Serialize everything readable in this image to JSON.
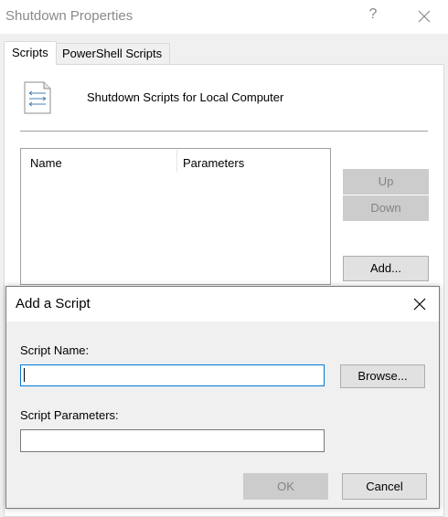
{
  "background_window": {
    "title": "Shutdown Properties",
    "help_glyph": "?",
    "tabs": [
      {
        "label": "Scripts",
        "selected": true
      },
      {
        "label": "PowerShell Scripts",
        "selected": false
      }
    ],
    "header_label": "Shutdown Scripts for Local Computer",
    "list_columns": [
      "Name",
      "Parameters"
    ],
    "buttons": {
      "up": "Up",
      "down": "Down",
      "add": "Add..."
    }
  },
  "dialog": {
    "title": "Add a Script",
    "script_name_label": "Script Name:",
    "script_name_value": "",
    "script_parameters_label": "Script Parameters:",
    "script_parameters_value": "",
    "browse": "Browse...",
    "ok": "OK",
    "cancel": "Cancel"
  },
  "colors": {
    "focus_border": "#0078d7",
    "disabled_button_bg": "#cccccc",
    "disabled_text": "#838383",
    "button_bg": "#e1e1e1",
    "window_bg": "#f0f0f0"
  },
  "icons": [
    "close-icon",
    "script-file-icon"
  ]
}
